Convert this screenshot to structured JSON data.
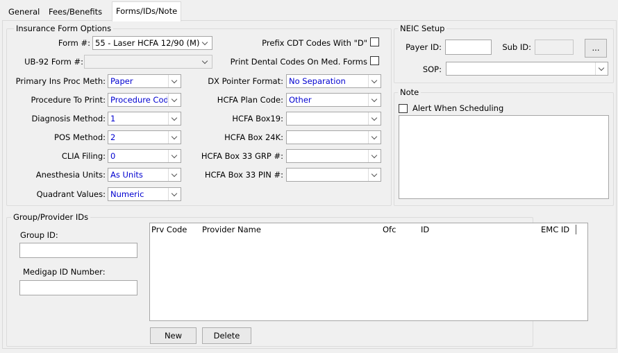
{
  "tabs": [
    "General",
    "Fees/Benefits",
    "Forms/IDs/Note"
  ],
  "insurance_form_options": {
    "legend": "Insurance Form Options",
    "form_label": "Form #:",
    "form_value": "55 - Laser HCFA 12/90 (M)",
    "ub92_label": "UB-92 Form #:",
    "ub92_value": "",
    "prefix_cdt_label": "Prefix CDT Codes With \"D\"",
    "print_dental_label": "Print Dental Codes On Med. Forms",
    "left_fields": [
      {
        "label": "Primary Ins Proc Meth:",
        "value": "Paper"
      },
      {
        "label": "Procedure To Print:",
        "value": "Procedure Code"
      },
      {
        "label": "Diagnosis Method:",
        "value": "1"
      },
      {
        "label": "POS Method:",
        "value": "2"
      },
      {
        "label": "CLIA Filing:",
        "value": "0"
      },
      {
        "label": "Anesthesia Units:",
        "value": "As Units"
      },
      {
        "label": "Quadrant Values:",
        "value": "Numeric"
      }
    ],
    "right_fields": [
      {
        "label": "DX Pointer Format:",
        "value": "No Separation"
      },
      {
        "label": "HCFA Plan Code:",
        "value": "Other"
      },
      {
        "label": "HCFA Box19:",
        "value": ""
      },
      {
        "label": "HCFA Box 24K:",
        "value": ""
      },
      {
        "label": "HCFA Box 33 GRP #:",
        "value": ""
      },
      {
        "label": "HCFA Box 33 PIN #:",
        "value": ""
      }
    ]
  },
  "neic_setup": {
    "legend": "NEIC Setup",
    "payer_id_label": "Payer ID:",
    "payer_id_value": "",
    "sub_id_label": "Sub ID:",
    "sub_id_value": "",
    "browse_label": "...",
    "sop_label": "SOP:",
    "sop_value": ""
  },
  "note": {
    "legend": "Note",
    "alert_label": "Alert When Scheduling",
    "text": ""
  },
  "group_provider_ids": {
    "legend": "Group/Provider IDs",
    "group_id_label": "Group ID:",
    "group_id_value": "",
    "medigap_label": "Medigap ID Number:",
    "medigap_value": "",
    "columns": [
      "Prv Code",
      "Provider Name",
      "Ofc",
      "ID",
      "EMC ID"
    ],
    "rows": [],
    "new_label": "New",
    "delete_label": "Delete"
  }
}
